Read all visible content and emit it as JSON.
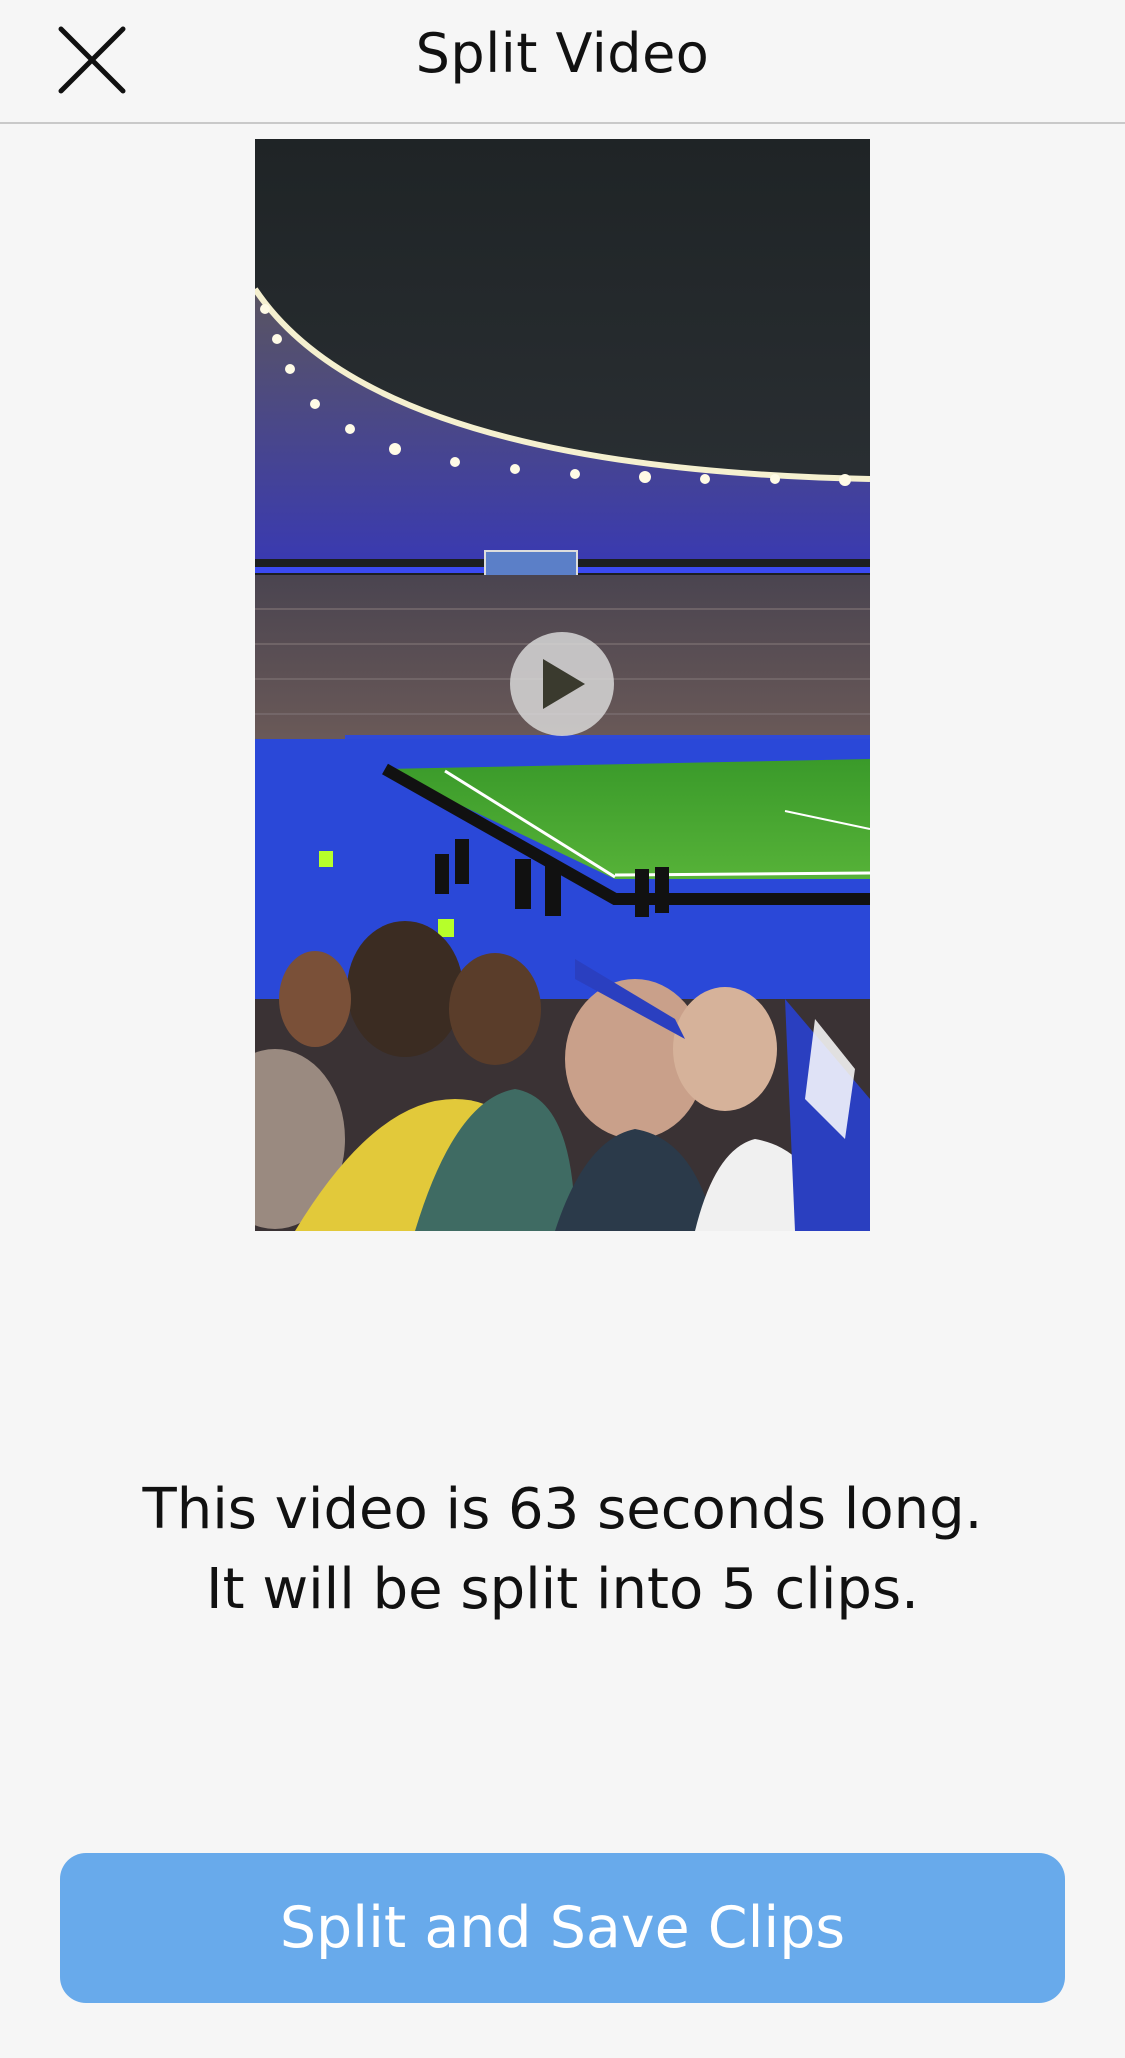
{
  "header": {
    "title": "Split Video",
    "close_icon": "close-icon"
  },
  "video": {
    "play_icon": "play-icon"
  },
  "info": {
    "line1": "This video is 63 seconds long.",
    "line2": "It will be split into 5 clips."
  },
  "actions": {
    "split_save_label": "Split and Save Clips"
  },
  "colors": {
    "background": "#f6f6f6",
    "primary_button": "#68aaeb",
    "field_green": "#3e9a2b",
    "track_blue": "#2a48d8"
  }
}
